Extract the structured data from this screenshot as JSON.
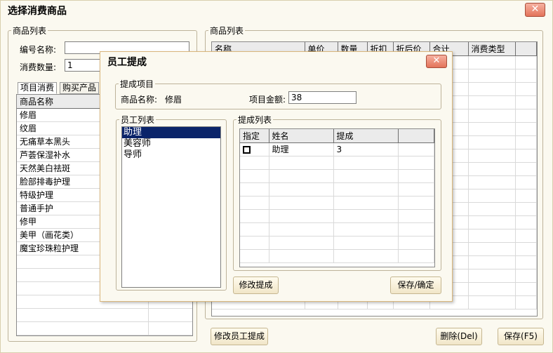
{
  "window": {
    "title": "选择消费商品",
    "close_glyph": "✕"
  },
  "left_panel": {
    "legend": "商品列表",
    "code_label": "编号名称:",
    "code_value": "",
    "qty_label": "消费数量:",
    "qty_value": "1",
    "tabs": [
      "项目消费",
      "购买产品"
    ],
    "list_header": "商品名称",
    "items": [
      "修眉",
      "纹眉",
      "无痛草本黑头",
      "芦荟保湿补水",
      "天然美白祛斑",
      "脸部排毒护理",
      "特级护理",
      "普通手护",
      "修甲",
      "美甲（画花类）",
      "魔宝珍珠粒护理"
    ]
  },
  "right_panel": {
    "legend": "商品列表",
    "columns": [
      "名称",
      "单价",
      "数量",
      "折扣",
      "折后价",
      "合计",
      "消费类型"
    ]
  },
  "buttons": {
    "modify_staff": "修改员工提成",
    "delete": "删除(Del)",
    "save": "保存(F5)"
  },
  "dialog": {
    "title": "员工提成",
    "close_glyph": "✕",
    "project_legend": "提成项目",
    "product_label": "商品名称:",
    "product_value": "修眉",
    "amount_label": "项目金额:",
    "amount_value": "38",
    "staff_legend": "员工列表",
    "staff": [
      "助理",
      "美容师",
      "导师"
    ],
    "comm_legend": "提成列表",
    "comm_columns": [
      "指定",
      "姓名",
      "提成"
    ],
    "comm_rows": [
      {
        "name": "助理",
        "value": "3"
      }
    ],
    "modify_btn": "修改提成",
    "confirm_btn": "保存/确定"
  }
}
